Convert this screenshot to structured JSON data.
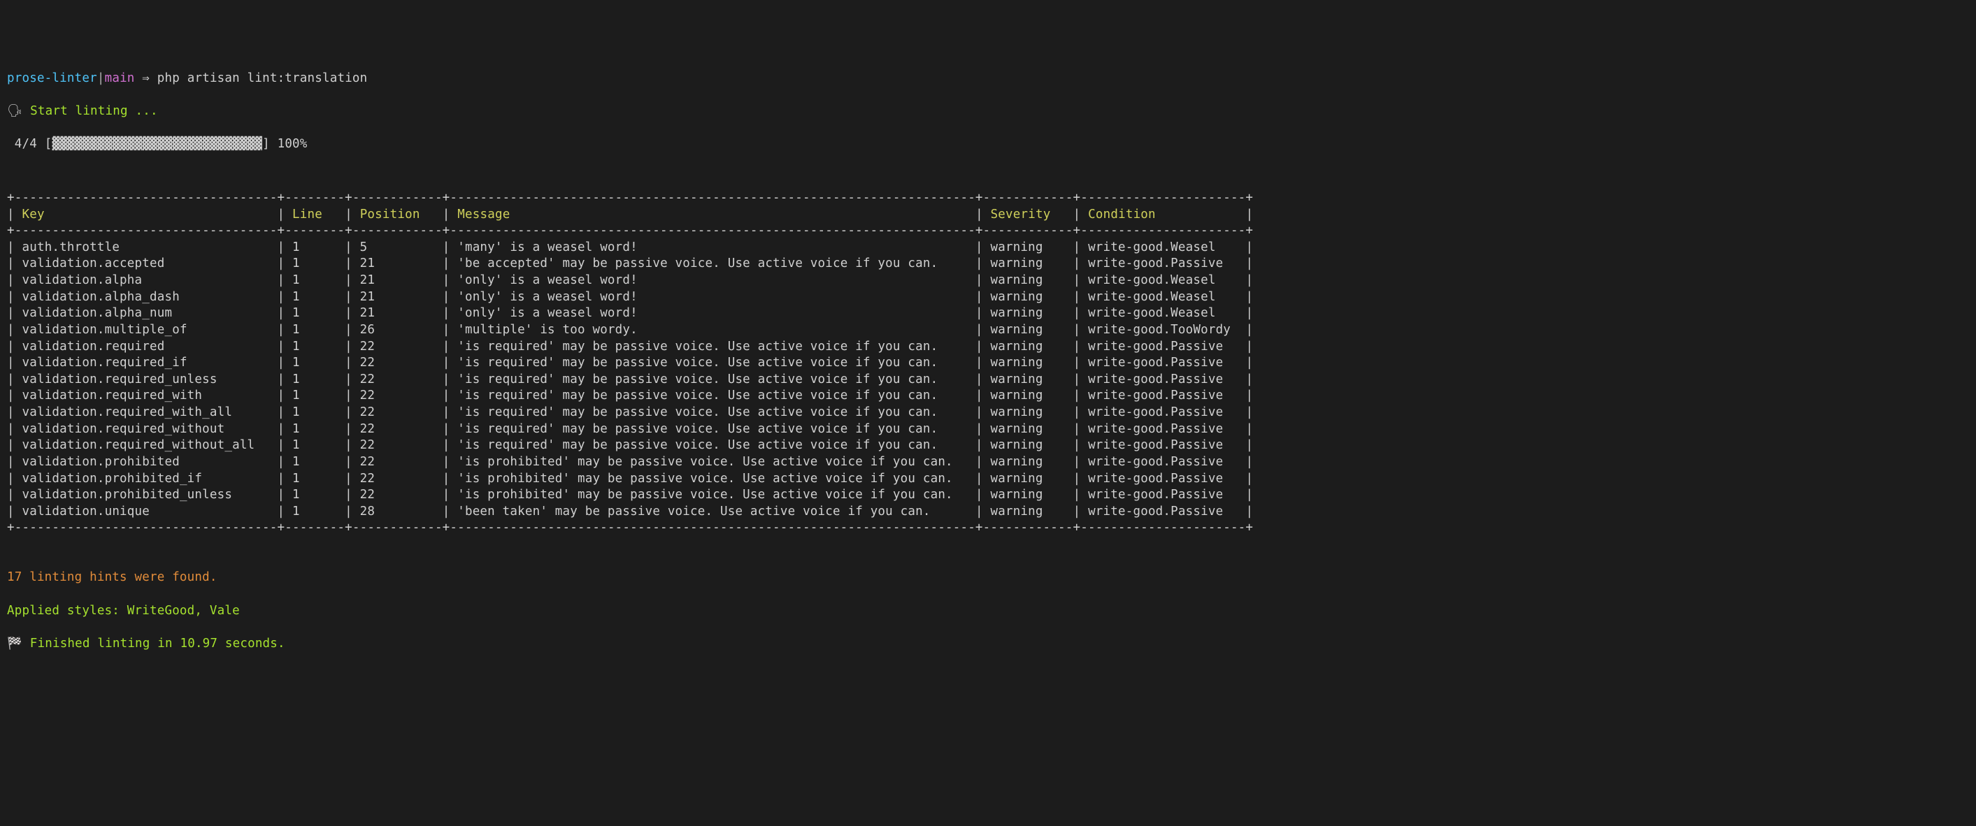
{
  "prompt": {
    "project": "prose-linter",
    "separator": "|",
    "branch": "main",
    "arrow": "⇒",
    "command": "php artisan lint:translation"
  },
  "start_line": {
    "icon": "🗣",
    "text": "Start linting ..."
  },
  "progress": {
    "current": "4",
    "total": "4",
    "bar_fill": "▓▓▓▓▓▓▓▓▓▓▓▓▓▓▓▓▓▓▓▓▓▓▓▓▓▓▓▓",
    "percent": "100%"
  },
  "table": {
    "columns": [
      "Key",
      "Line",
      "Position",
      "Message",
      "Severity",
      "Condition"
    ],
    "widths": [
      33,
      6,
      10,
      68,
      10,
      20
    ],
    "rows": [
      {
        "key": "auth.throttle",
        "line": "1",
        "position": "5",
        "message": "'many' is a weasel word!",
        "severity": "warning",
        "condition": "write-good.Weasel"
      },
      {
        "key": "validation.accepted",
        "line": "1",
        "position": "21",
        "message": "'be accepted' may be passive voice. Use active voice if you can.",
        "severity": "warning",
        "condition": "write-good.Passive"
      },
      {
        "key": "validation.alpha",
        "line": "1",
        "position": "21",
        "message": "'only' is a weasel word!",
        "severity": "warning",
        "condition": "write-good.Weasel"
      },
      {
        "key": "validation.alpha_dash",
        "line": "1",
        "position": "21",
        "message": "'only' is a weasel word!",
        "severity": "warning",
        "condition": "write-good.Weasel"
      },
      {
        "key": "validation.alpha_num",
        "line": "1",
        "position": "21",
        "message": "'only' is a weasel word!",
        "severity": "warning",
        "condition": "write-good.Weasel"
      },
      {
        "key": "validation.multiple_of",
        "line": "1",
        "position": "26",
        "message": "'multiple' is too wordy.",
        "severity": "warning",
        "condition": "write-good.TooWordy"
      },
      {
        "key": "validation.required",
        "line": "1",
        "position": "22",
        "message": "'is required' may be passive voice. Use active voice if you can.",
        "severity": "warning",
        "condition": "write-good.Passive"
      },
      {
        "key": "validation.required_if",
        "line": "1",
        "position": "22",
        "message": "'is required' may be passive voice. Use active voice if you can.",
        "severity": "warning",
        "condition": "write-good.Passive"
      },
      {
        "key": "validation.required_unless",
        "line": "1",
        "position": "22",
        "message": "'is required' may be passive voice. Use active voice if you can.",
        "severity": "warning",
        "condition": "write-good.Passive"
      },
      {
        "key": "validation.required_with",
        "line": "1",
        "position": "22",
        "message": "'is required' may be passive voice. Use active voice if you can.",
        "severity": "warning",
        "condition": "write-good.Passive"
      },
      {
        "key": "validation.required_with_all",
        "line": "1",
        "position": "22",
        "message": "'is required' may be passive voice. Use active voice if you can.",
        "severity": "warning",
        "condition": "write-good.Passive"
      },
      {
        "key": "validation.required_without",
        "line": "1",
        "position": "22",
        "message": "'is required' may be passive voice. Use active voice if you can.",
        "severity": "warning",
        "condition": "write-good.Passive"
      },
      {
        "key": "validation.required_without_all",
        "line": "1",
        "position": "22",
        "message": "'is required' may be passive voice. Use active voice if you can.",
        "severity": "warning",
        "condition": "write-good.Passive"
      },
      {
        "key": "validation.prohibited",
        "line": "1",
        "position": "22",
        "message": "'is prohibited' may be passive voice. Use active voice if you can.",
        "severity": "warning",
        "condition": "write-good.Passive"
      },
      {
        "key": "validation.prohibited_if",
        "line": "1",
        "position": "22",
        "message": "'is prohibited' may be passive voice. Use active voice if you can.",
        "severity": "warning",
        "condition": "write-good.Passive"
      },
      {
        "key": "validation.prohibited_unless",
        "line": "1",
        "position": "22",
        "message": "'is prohibited' may be passive voice. Use active voice if you can.",
        "severity": "warning",
        "condition": "write-good.Passive"
      },
      {
        "key": "validation.unique",
        "line": "1",
        "position": "28",
        "message": "'been taken' may be passive voice. Use active voice if you can.",
        "severity": "warning",
        "condition": "write-good.Passive"
      }
    ]
  },
  "summary": {
    "hints": "17 linting hints were found.",
    "styles": "Applied styles: WriteGood, Vale",
    "finished_icon": "🏁",
    "finished_text": "Finished linting in 10.97 seconds."
  }
}
